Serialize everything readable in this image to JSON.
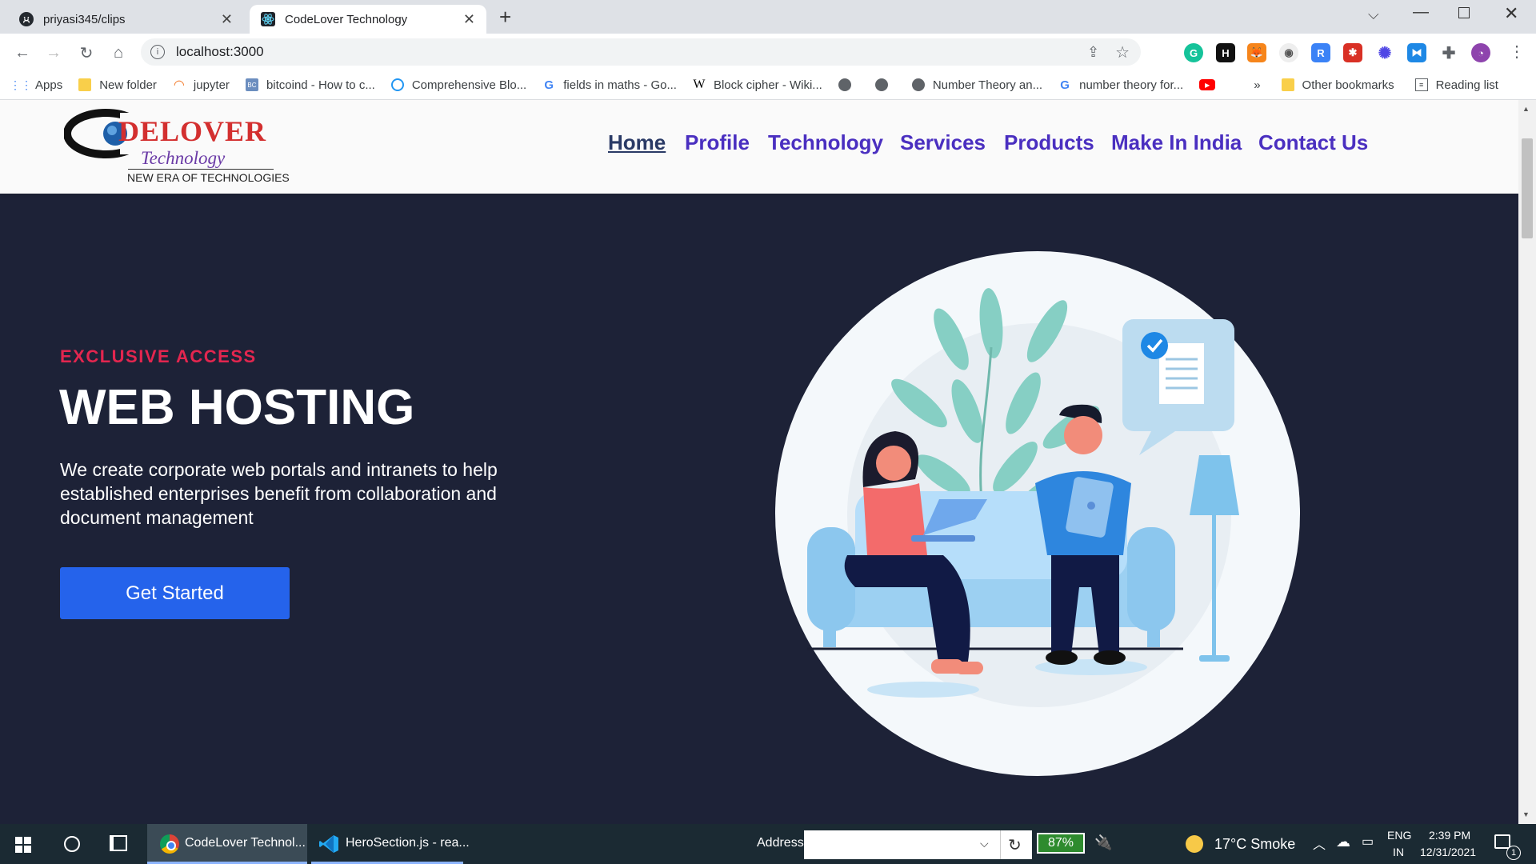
{
  "browser": {
    "tabs": [
      {
        "title": "priyasi345/clips",
        "icon": "github-icon",
        "active": false
      },
      {
        "title": "CodeLover Technology",
        "icon": "react-icon",
        "active": true
      }
    ],
    "new_tab_symbol": "+",
    "address": "localhost:3000",
    "bookmarks": [
      {
        "label": "Apps",
        "icon": "apps-grid-icon"
      },
      {
        "label": "New folder",
        "icon": "folder-icon"
      },
      {
        "label": "jupyter",
        "icon": "jupyter-icon"
      },
      {
        "label": "bitcoind - How to c...",
        "icon": "bc-icon"
      },
      {
        "label": "Comprehensive Blo...",
        "icon": "globe-icon"
      },
      {
        "label": "fields in maths - Go...",
        "icon": "google-icon"
      },
      {
        "label": "Block cipher - Wiki...",
        "icon": "wikipedia-icon"
      },
      {
        "label": "Number Theory an...",
        "icon": "globe-icon"
      },
      {
        "label": "number theory for...",
        "icon": "google-icon"
      }
    ],
    "overflow_symbol": "»",
    "other_bookmarks": "Other bookmarks",
    "reading_list": "Reading list"
  },
  "site": {
    "logo": {
      "brand": "DELOVER",
      "brand_prefix": "CO",
      "sub": "Technology",
      "tagline": "NEW ERA OF TECHNOLOGIES"
    },
    "nav": [
      {
        "label": "Home",
        "active": true
      },
      {
        "label": "Profile",
        "active": false
      },
      {
        "label": "Technology",
        "active": false
      },
      {
        "label": "Services",
        "active": false
      },
      {
        "label": "Products",
        "active": false
      },
      {
        "label": "Make In India",
        "active": false
      },
      {
        "label": "Contact Us",
        "active": false
      }
    ],
    "hero": {
      "eyebrow": "EXCLUSIVE ACCESS",
      "title": "WEB HOSTING",
      "description": "We create corporate web portals and intranets to help established enterprises benefit from collaboration and document management",
      "cta": "Get Started"
    }
  },
  "taskbar": {
    "apps": [
      {
        "label": "CodeLover Technol...",
        "icon": "chrome-icon",
        "active": true
      },
      {
        "label": "HeroSection.js - rea...",
        "icon": "vscode-icon",
        "active": false
      }
    ],
    "address_label": "Address",
    "battery_percent": "87%",
    "weather": "17°C  Smoke",
    "lang_line1": "ENG",
    "lang_line2": "IN",
    "time": "2:39 PM",
    "date": "12/31/2021",
    "notification_count": "1"
  },
  "colors": {
    "hero_bg": "#1d2237",
    "eyebrow": "#e3264f",
    "cta_bg": "#2563eb",
    "nav_link": "#4a2fc0"
  }
}
